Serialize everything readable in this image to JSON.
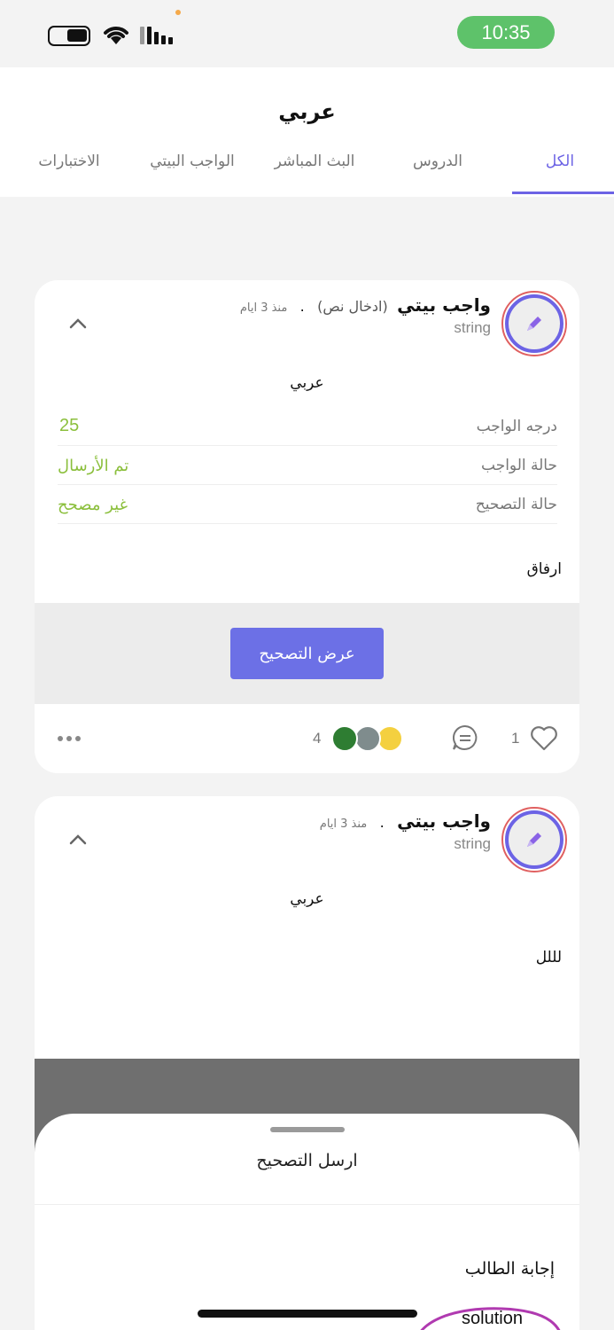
{
  "status_bar": {
    "time": "10:35",
    "icons": [
      "battery-icon",
      "wifi-icon",
      "signal-icon"
    ],
    "time_pill_color": "#5ec26a"
  },
  "header": {
    "title": "عربي",
    "tabs": [
      {
        "label": "الكل",
        "active": true
      },
      {
        "label": "الدروس",
        "active": false
      },
      {
        "label": "البث المباشر",
        "active": false
      },
      {
        "label": "الواجب البيتي",
        "active": false
      },
      {
        "label": "الاختبارات",
        "active": false
      }
    ],
    "accent_color": "#6c63e5"
  },
  "posts": [
    {
      "title": "واجب بيتي",
      "subtitle": "(ادخال نص)",
      "separator": ".",
      "time": "منذ 3 ايام",
      "author": "string",
      "subject": "عربي",
      "details": [
        {
          "label": "درجه الواجب",
          "value": "25"
        },
        {
          "label": "حالة الواجب",
          "value": "تم الأرسال"
        },
        {
          "label": "حالة التصحيح",
          "value": "غير مصحح"
        }
      ],
      "attachment_label": "ارفاق",
      "action_button": "عرض التصحيح",
      "likes": "1",
      "viewers_count": "4"
    },
    {
      "title": "واجب بيتي",
      "separator": ".",
      "time": "منذ 3 ايام",
      "author": "string",
      "subject": "عربي",
      "body": "لللل"
    }
  ],
  "bottom_sheet": {
    "title": "ارسل التصحيح",
    "answer_label": "إجابة الطالب",
    "answer_value": "solution"
  },
  "colors": {
    "status_value_green": "#8bbf3c",
    "button_purple": "#6c70e6",
    "avatar_ring_red": "#e06060"
  }
}
